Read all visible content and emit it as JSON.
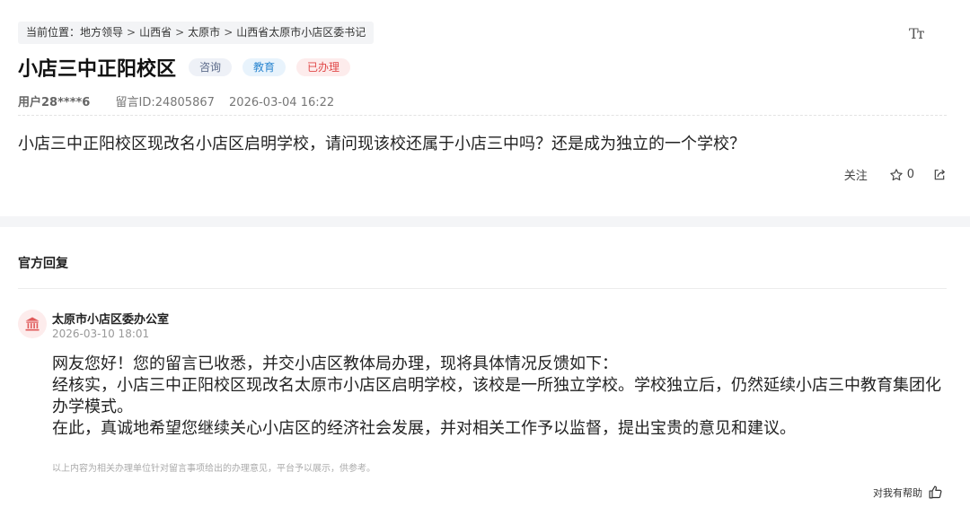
{
  "breadcrumb": {
    "prefix": "当前位置：",
    "items": [
      "地方领导",
      "山西省",
      "太原市",
      "山西省太原市小店区委书记"
    ],
    "separator": ">"
  },
  "font_toggle": "Tт",
  "post": {
    "title": "小店三中正阳校区",
    "tags": {
      "consult": "咨询",
      "education": "教育",
      "status": "已办理"
    },
    "user": "用户28****6",
    "message_id": "留言ID:24805867",
    "datetime": "2026-03-04 16:22",
    "question": "小店三中正阳校区现改名小店区启明学校，请问现该校还属于小店三中吗？还是成为独立的一个学校？"
  },
  "actions": {
    "follow_label": "关注",
    "like_count": "0"
  },
  "official": {
    "section_title": "官方回复",
    "department": "太原市小店区委办公室",
    "reply_time": "2026-03-10 18:01",
    "paragraphs": [
      "网友您好！您的留言已收悉，并交小店区教体局办理，现将具体情况反馈如下：",
      "经核实，小店三中正阳校区现改名太原市小店区启明学校，该校是一所独立学校。学校独立后，仍然延续小店三中教育集团化办学模式。",
      "在此，真诚地希望您继续关心小店区的经济社会发展，并对相关工作予以监督，提出宝贵的意见和建议。"
    ],
    "disclaimer": "以上内容为相关办理单位针对留言事项给出的办理意见，平台予以展示，供参考。",
    "helpful_label": "对我有帮助"
  },
  "colors": {
    "tag_status": "#e04848",
    "tag_education": "#2b86d0",
    "tag_consult": "#5b6a8a",
    "avatar_icon": "#e05a5a"
  },
  "icons": [
    "font-size-icon",
    "star-icon",
    "share-icon",
    "government-building-icon",
    "thumbs-up-icon"
  ]
}
